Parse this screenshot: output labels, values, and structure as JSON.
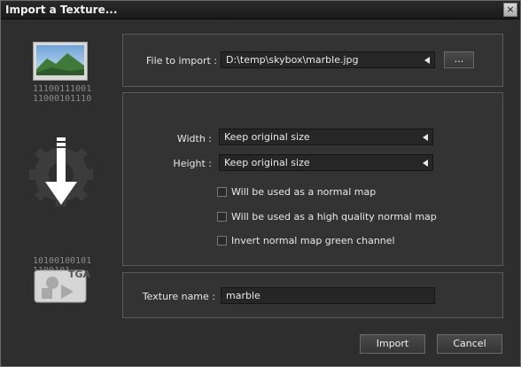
{
  "window": {
    "title": "Import a Texture...",
    "close_glyph": "×"
  },
  "file": {
    "label": "File to import :",
    "value": "D:\\temp\\skybox\\marble.jpg",
    "browse_label": "..."
  },
  "size": {
    "width_label": "Width :",
    "width_value": "Keep original size",
    "height_label": "Height :",
    "height_value": "Keep original size"
  },
  "options": [
    {
      "label": "Will be used as a normal map",
      "checked": false
    },
    {
      "label": "Will be used as a high quality normal map",
      "checked": false
    },
    {
      "label": "Invert normal map green channel",
      "checked": false
    }
  ],
  "texture": {
    "label": "Texture name :",
    "value": "marble"
  },
  "buttons": {
    "import": "Import",
    "cancel": "Cancel"
  },
  "illustration": {
    "top_binary": [
      "11100111001",
      "11000101110"
    ],
    "bottom_binary": [
      "10100100101",
      "1100101"
    ],
    "badge": "TGA",
    "icons": [
      "image-file-icon",
      "gear-download-arrow-icon",
      "texture-file-icon"
    ]
  }
}
